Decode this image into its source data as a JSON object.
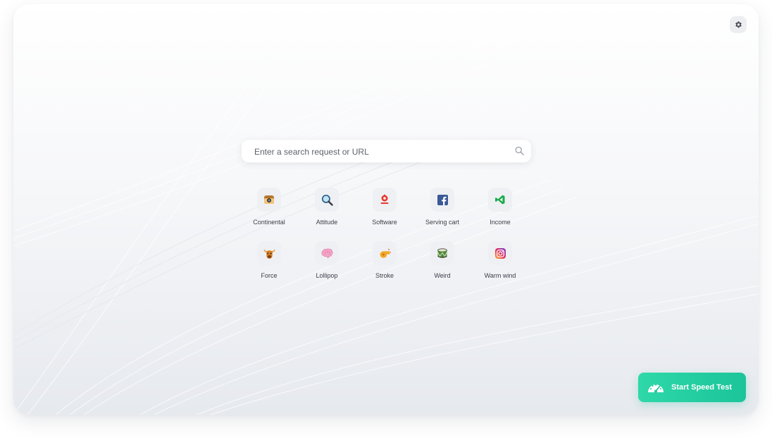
{
  "search": {
    "placeholder": "Enter a search request or URL"
  },
  "shortcuts": [
    {
      "label": "Continental",
      "icon": "camera-icon"
    },
    {
      "label": "Attitude",
      "icon": "magnifier-icon"
    },
    {
      "label": "Software",
      "icon": "gear-flag-icon"
    },
    {
      "label": "Serving cart",
      "icon": "facebook-icon"
    },
    {
      "label": "Income",
      "icon": "vscode-icon"
    },
    {
      "label": "Force",
      "icon": "bull-icon"
    },
    {
      "label": "Lollipop",
      "icon": "brain-icon"
    },
    {
      "label": "Stroke",
      "icon": "whistle-icon"
    },
    {
      "label": "Weird",
      "icon": "drum-icon"
    },
    {
      "label": "Warm wind",
      "icon": "instagram-icon"
    }
  ],
  "speed_test": {
    "label": "Start Speed Test"
  },
  "colors": {
    "accent": "#1cc49a",
    "background": "#f6f7f9"
  }
}
